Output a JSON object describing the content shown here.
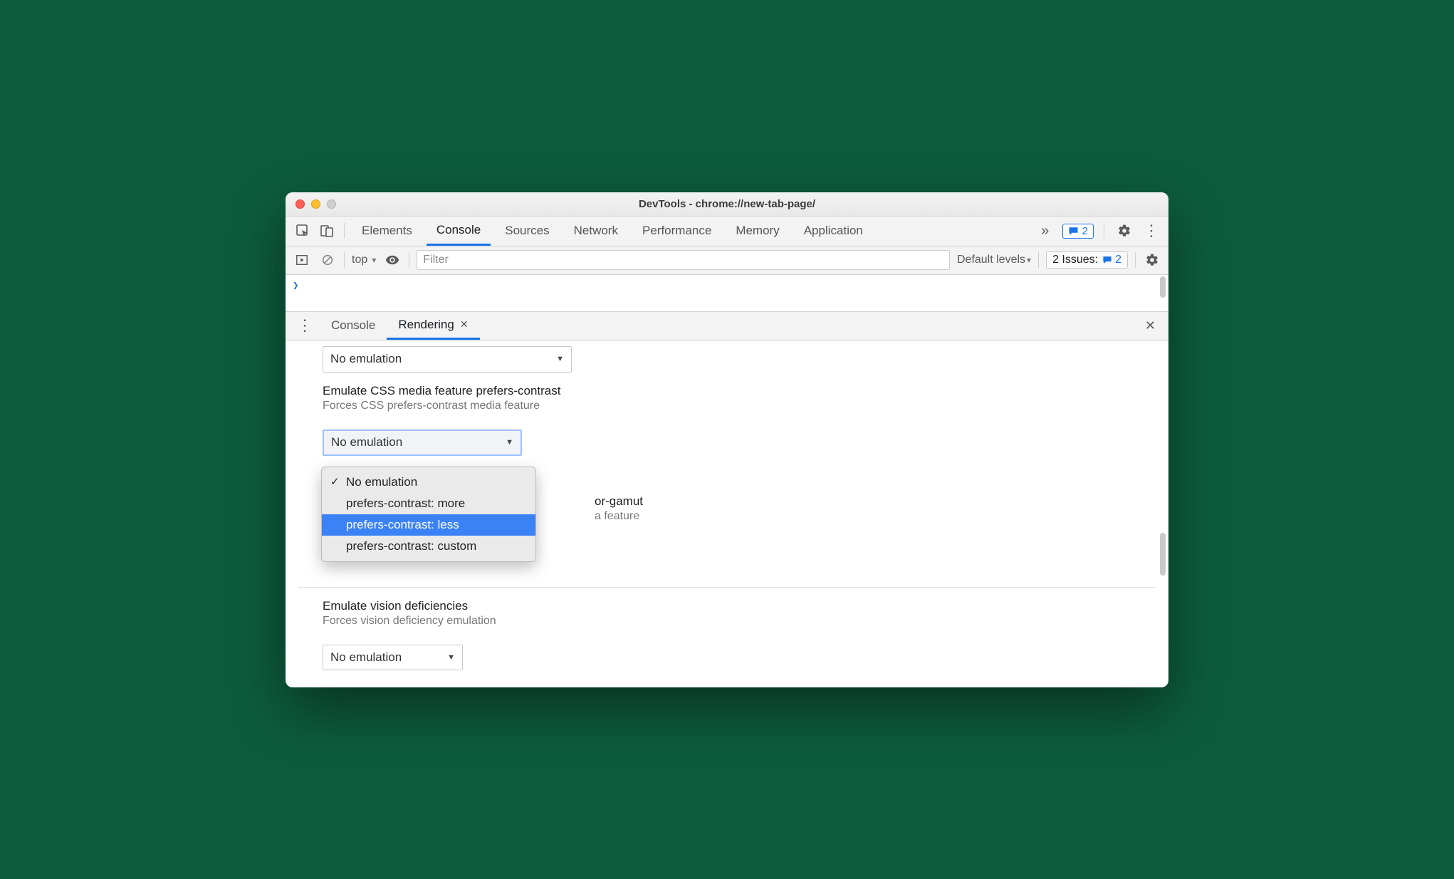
{
  "window": {
    "title": "DevTools - chrome://new-tab-page/"
  },
  "tabs": {
    "items": [
      "Elements",
      "Console",
      "Sources",
      "Network",
      "Performance",
      "Memory",
      "Application"
    ],
    "active": "Console",
    "overflow_glyph": "»",
    "issue_badge": "2"
  },
  "console_toolbar": {
    "context": "top",
    "filter_placeholder": "Filter",
    "levels": "Default levels",
    "issues_label": "2 Issues:",
    "issues_count": "2"
  },
  "drawer": {
    "menu_glyph": "⋮",
    "tabs": [
      "Console",
      "Rendering"
    ],
    "active": "Rendering"
  },
  "rendering": {
    "top_select_value": "No emulation",
    "contrast": {
      "title": "Emulate CSS media feature prefers-contrast",
      "desc": "Forces CSS prefers-contrast media feature",
      "select_value": "No emulation"
    },
    "dropdown_items": [
      {
        "label": "No emulation",
        "checked": true,
        "highlight": false
      },
      {
        "label": "prefers-contrast: more",
        "checked": false,
        "highlight": false
      },
      {
        "label": "prefers-contrast: less",
        "checked": false,
        "highlight": true
      },
      {
        "label": "prefers-contrast: custom",
        "checked": false,
        "highlight": false
      }
    ],
    "gamut_peek_title_suffix": "or-gamut",
    "gamut_peek_desc_suffix": "a feature",
    "vision": {
      "title": "Emulate vision deficiencies",
      "desc": "Forces vision deficiency emulation",
      "select_value": "No emulation"
    }
  }
}
